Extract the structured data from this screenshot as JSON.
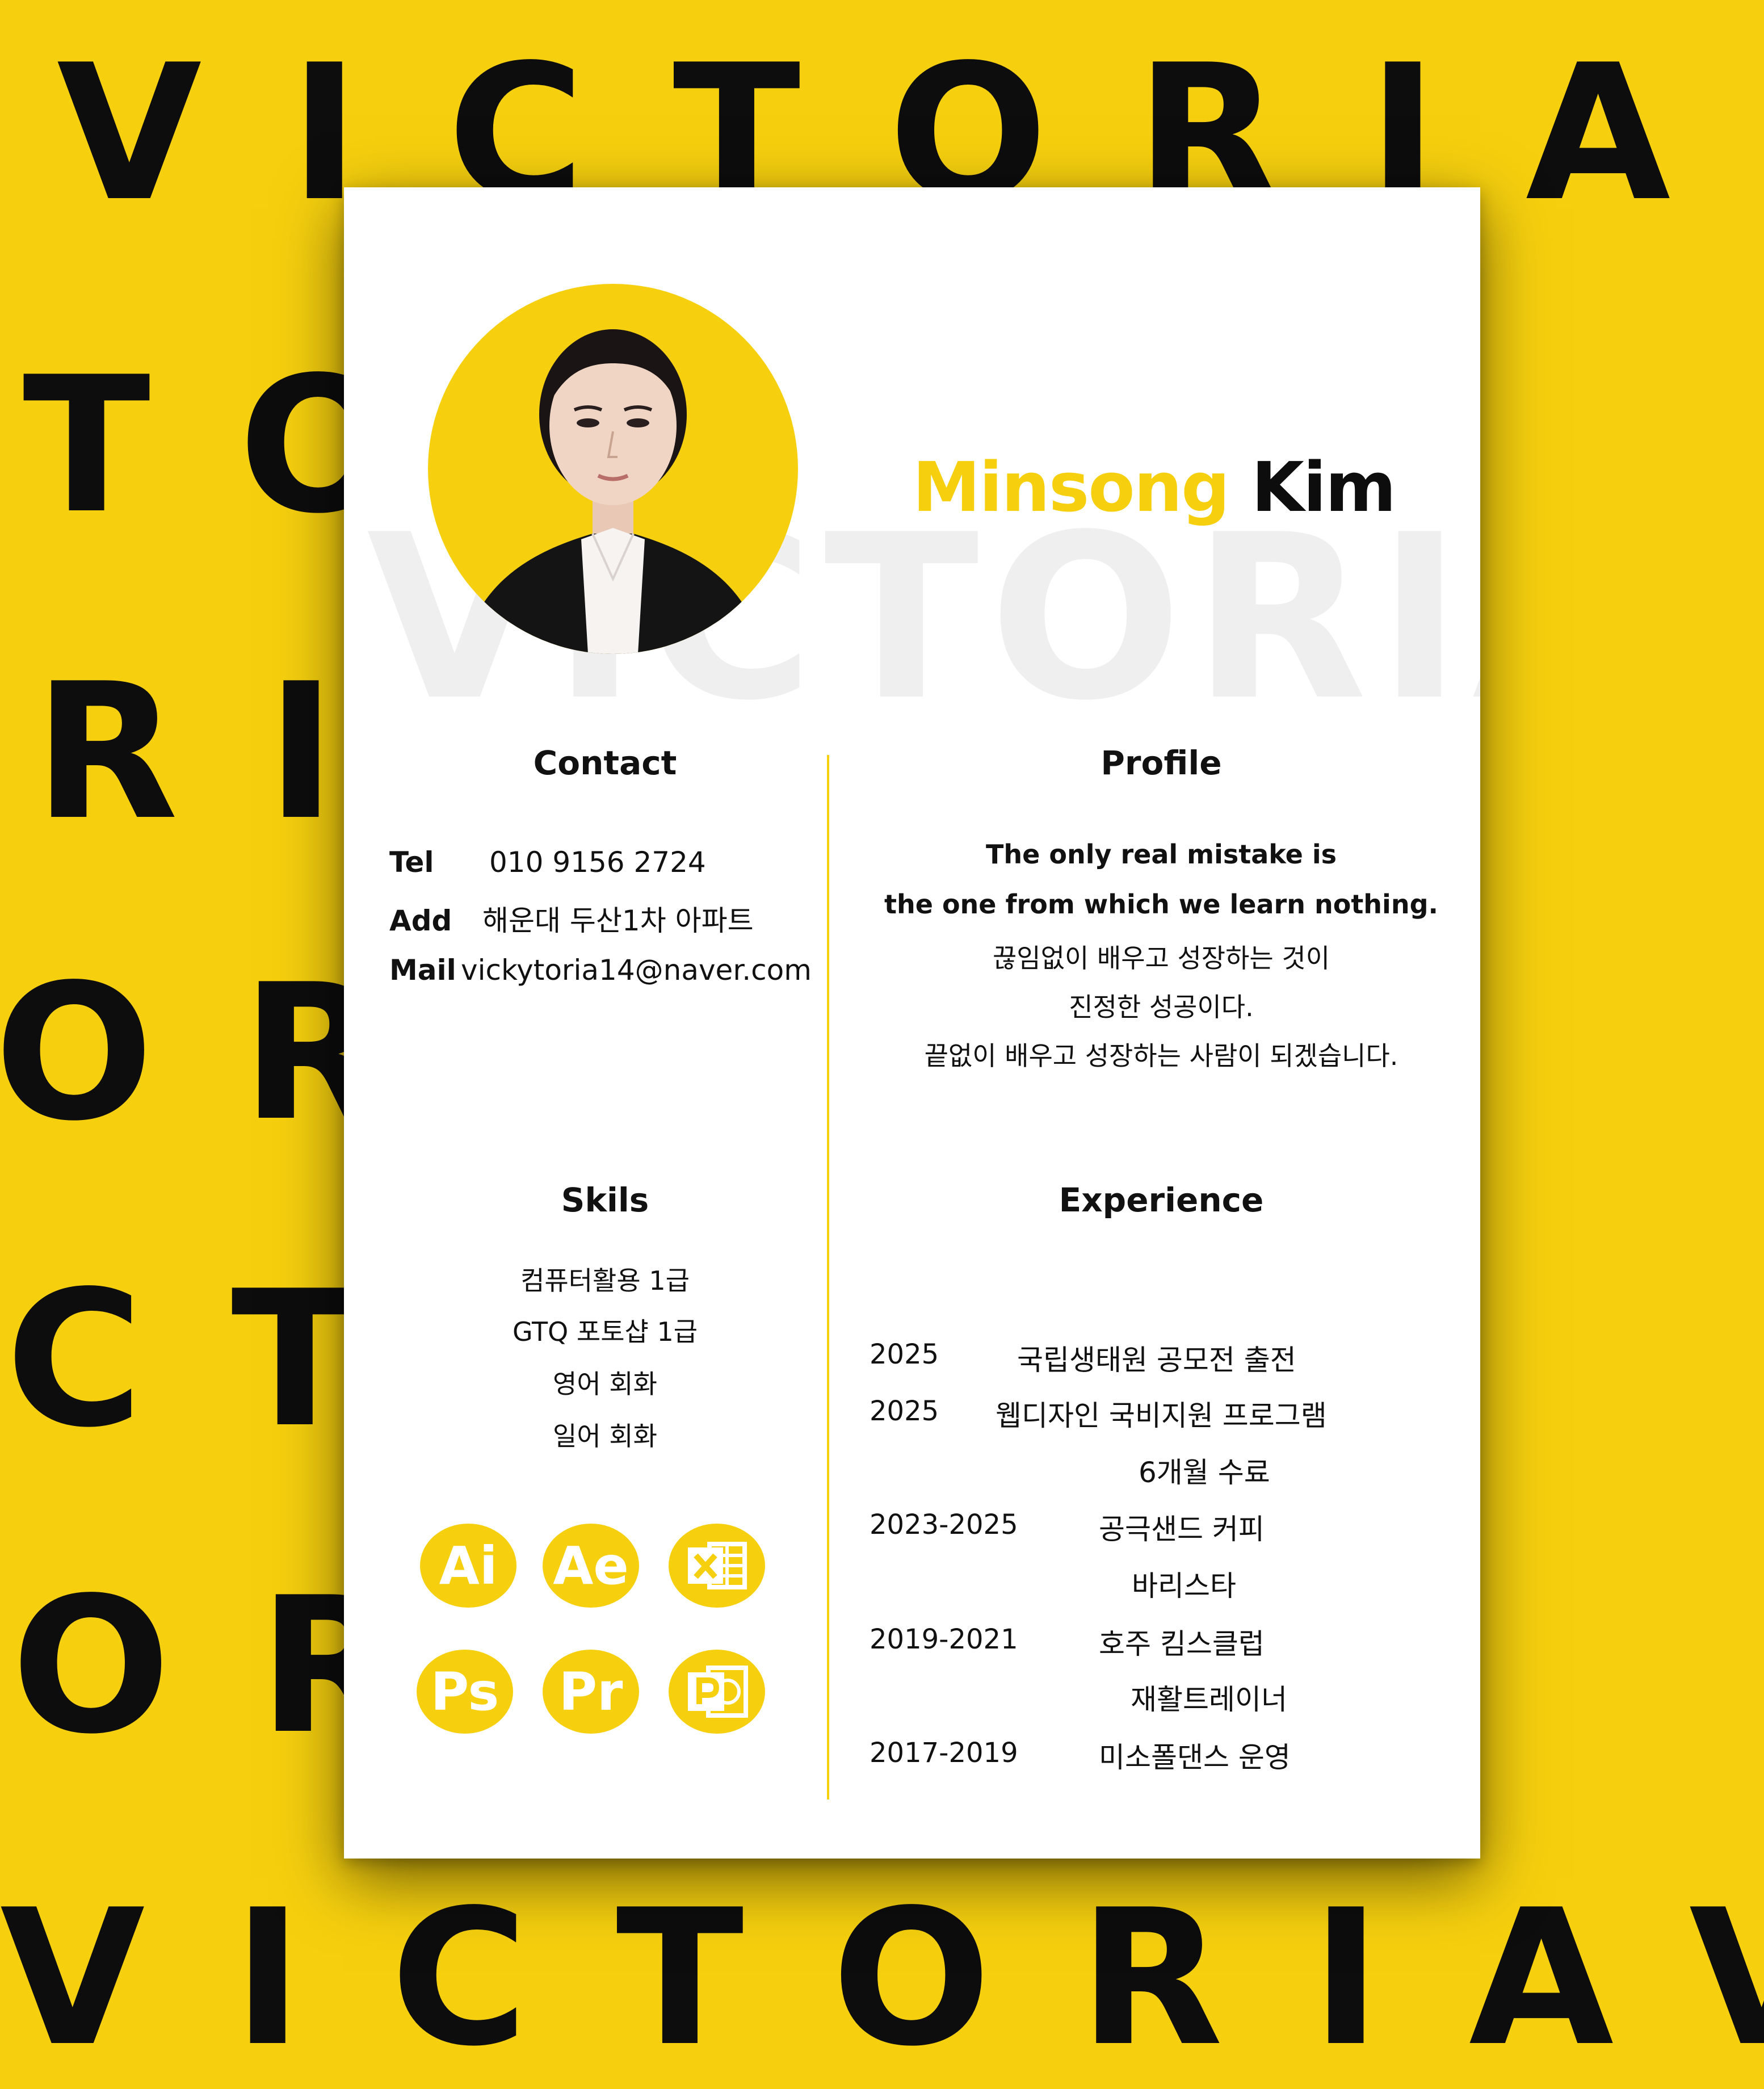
{
  "background": {
    "pattern_word": "VICTORIA",
    "rows": [
      "VICTORIA",
      "TORIACT",
      "RIC RI",
      "ORIRR",
      "CT  ORI",
      "ORICTI",
      "VICTORIAV"
    ],
    "colors": {
      "yellow": "#f6d00e",
      "black": "#0d0d0d"
    }
  },
  "sheet": {
    "watermark": "VICTORIA",
    "name": {
      "first": "Minsong",
      "last": "Kim"
    },
    "contact": {
      "heading": "Contact",
      "rows": [
        {
          "label": "Tel",
          "value": "010 9156 2724"
        },
        {
          "label": "Add",
          "value": "해운대 두산1차 아파트"
        },
        {
          "label": "Mail",
          "value": "vickytoria14@naver.com"
        }
      ]
    },
    "profile": {
      "heading": "Profile",
      "lines": [
        "The only real mistake is",
        "the one from which we learn nothing.",
        "끊임없이 배우고 성장하는 것이",
        "진정한 성공이다.",
        "끝없이 배우고 성장하는 사람이 되겠습니다."
      ]
    },
    "skills": {
      "heading": "Skils",
      "lines": [
        "컴퓨터활용 1급",
        "GTQ 포토샵 1급",
        "영어 회화",
        "일어 회화"
      ],
      "badges": [
        "Ai",
        "Ae",
        "excel-icon",
        "Ps",
        "Pr",
        "powerpoint-icon"
      ]
    },
    "experience": {
      "heading": "Experience",
      "items": [
        {
          "year": "2025",
          "lines": [
            "국립생태원 공모전 출전"
          ]
        },
        {
          "year": "2025",
          "lines": [
            "웹디자인 국비지원 프로그램",
            "6개월 수료"
          ]
        },
        {
          "year": "2023-2025",
          "lines": [
            "공극샌드 커피",
            "바리스타"
          ]
        },
        {
          "year": "2019-2021",
          "lines": [
            "호주 킴스클럽",
            "재활트레이너"
          ]
        },
        {
          "year": "2017-2019",
          "lines": [
            "미소폴댄스 운영"
          ]
        }
      ]
    }
  }
}
